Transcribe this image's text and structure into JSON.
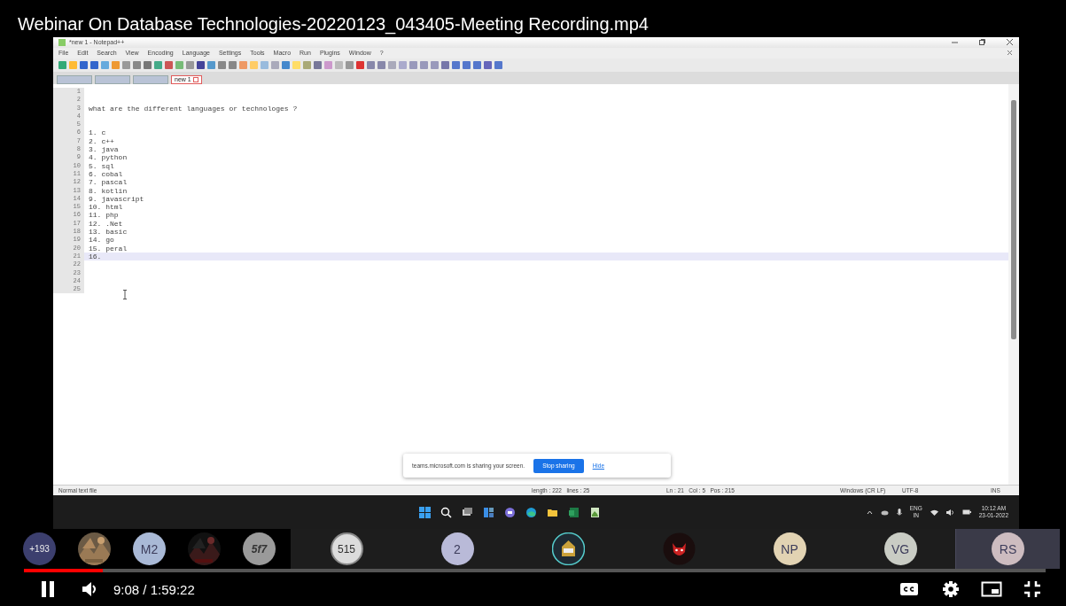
{
  "video": {
    "title": "Webinar On Database Technologies-20220123_043405-Meeting Recording.mp4"
  },
  "editor_window": {
    "title": "*new 1 - Notepad++",
    "menu": [
      "File",
      "Edit",
      "Search",
      "View",
      "Encoding",
      "Language",
      "Settings",
      "Tools",
      "Macro",
      "Run",
      "Plugins",
      "Window",
      "?"
    ],
    "tabs": [
      {
        "selected": false
      },
      {
        "selected": false
      },
      {
        "selected": false
      },
      {
        "label": "new 1",
        "selected": true
      }
    ],
    "lines": [
      {
        "number": "1",
        "current": false
      },
      {
        "number": "2",
        "current": false
      },
      {
        "number": "3",
        "text": "what are the different languages or technologes ?",
        "current": false
      },
      {
        "number": "4",
        "current": false
      },
      {
        "number": "5",
        "current": false
      },
      {
        "number": "6",
        "text": "1. c",
        "current": false
      },
      {
        "number": "7",
        "text": "2. c++",
        "current": false
      },
      {
        "number": "8",
        "text": "3. java",
        "current": false
      },
      {
        "number": "9",
        "text": "4. python",
        "current": false
      },
      {
        "number": "10",
        "text": "5. sql",
        "current": false
      },
      {
        "number": "11",
        "text": "6. cobal",
        "current": false
      },
      {
        "number": "12",
        "text": "7. pascal",
        "current": false
      },
      {
        "number": "13",
        "text": "8. kotlin",
        "current": false
      },
      {
        "number": "14",
        "text": "9. javascript",
        "current": false
      },
      {
        "number": "15",
        "text": "10. html",
        "current": false
      },
      {
        "number": "16",
        "text": "11. php",
        "current": false
      },
      {
        "number": "17",
        "text": "12. .Net",
        "current": false
      },
      {
        "number": "18",
        "text": "13. basic",
        "current": false
      },
      {
        "number": "19",
        "text": "14. go",
        "current": false
      },
      {
        "number": "20",
        "text": "15. peral",
        "current": false
      },
      {
        "number": "21",
        "text": "16.",
        "current": true
      },
      {
        "number": "22",
        "current": false
      },
      {
        "number": "23",
        "current": false
      },
      {
        "number": "24",
        "current": false
      },
      {
        "number": "25",
        "current": false
      }
    ],
    "share_notice": {
      "message": "teams.microsoft.com is sharing your screen.",
      "stop_button": "Stop sharing",
      "hide_link": "Hide"
    },
    "status_bar": {
      "file_type": "Normal text file",
      "length": "length : 222   lines : 25",
      "position": "Ln : 21   Col : 5   Pos : 215",
      "eol": "Windows (CR LF)",
      "encoding": "UTF-8",
      "mode": "INS"
    }
  },
  "taskbar": {
    "language": "ENG",
    "region": "IN",
    "time": "10:12 AM",
    "date": "23-01-2022"
  },
  "participants": [
    {
      "kind": "count",
      "text": "+193",
      "color": "#3c3f6e",
      "selected": false
    },
    {
      "kind": "picture",
      "selected": false
    },
    {
      "kind": "initials",
      "text": "M2",
      "color": "#a9b9d6",
      "selected": false
    },
    {
      "kind": "picture",
      "selected": false
    },
    {
      "kind": "emblem",
      "text": "5f7",
      "color": "#9a9a9a",
      "selected": false
    },
    {
      "kind": "emblem",
      "text": "515",
      "color": "#dcdcdc",
      "selected": false
    },
    {
      "kind": "initials",
      "text": "2",
      "color": "#b9bad8",
      "selected": false
    },
    {
      "kind": "character",
      "color": "#1e2a33",
      "selected": false
    },
    {
      "kind": "character",
      "color": "#1a0d0d",
      "selected": false
    },
    {
      "kind": "initials",
      "text": "NP",
      "color": "#e2d3b3",
      "selected": false
    },
    {
      "kind": "initials",
      "text": "VG",
      "color": "#c9ccc4",
      "selected": false
    },
    {
      "kind": "initials",
      "text": "RS",
      "color": "#cdbcc0",
      "selected": true
    }
  ],
  "player": {
    "progress": {
      "level": 0.077
    },
    "time": "9:08 / 1:59:22",
    "playing": true
  }
}
